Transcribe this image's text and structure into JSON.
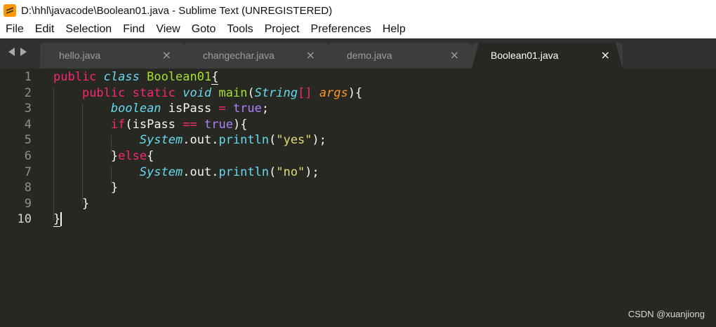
{
  "window": {
    "title": "D:\\hhl\\javacode\\Boolean01.java - Sublime Text (UNREGISTERED)",
    "icon": "sublime-text-icon"
  },
  "menu": [
    "File",
    "Edit",
    "Selection",
    "Find",
    "View",
    "Goto",
    "Tools",
    "Project",
    "Preferences",
    "Help"
  ],
  "tabs": [
    {
      "label": "hello.java",
      "close": "×",
      "active": false
    },
    {
      "label": "changechar.java",
      "close": "×",
      "active": false
    },
    {
      "label": "demo.java",
      "close": "×",
      "active": false
    },
    {
      "label": "Boolean01.java",
      "close": "×",
      "active": true
    }
  ],
  "editor": {
    "current_line": 10,
    "lines": [
      {
        "num": "1",
        "tokens": [
          {
            "t": "public",
            "c": "kw"
          },
          {
            "t": " ",
            "c": "plain"
          },
          {
            "t": "class",
            "c": "type"
          },
          {
            "t": " ",
            "c": "plain"
          },
          {
            "t": "Boolean01",
            "c": "cls"
          },
          {
            "t": "{",
            "c": "plain under"
          }
        ]
      },
      {
        "num": "2",
        "tokens": [
          {
            "t": "    ",
            "c": "plain"
          },
          {
            "t": "public",
            "c": "kw"
          },
          {
            "t": " ",
            "c": "plain"
          },
          {
            "t": "static",
            "c": "kw"
          },
          {
            "t": " ",
            "c": "plain"
          },
          {
            "t": "void",
            "c": "type"
          },
          {
            "t": " ",
            "c": "plain"
          },
          {
            "t": "main",
            "c": "cls"
          },
          {
            "t": "(",
            "c": "plain"
          },
          {
            "t": "String",
            "c": "type"
          },
          {
            "t": "[]",
            "c": "kw"
          },
          {
            "t": " ",
            "c": "plain"
          },
          {
            "t": "args",
            "c": "param"
          },
          {
            "t": "){",
            "c": "plain"
          }
        ]
      },
      {
        "num": "3",
        "tokens": [
          {
            "t": "        ",
            "c": "plain"
          },
          {
            "t": "boolean",
            "c": "type"
          },
          {
            "t": " isPass ",
            "c": "plain"
          },
          {
            "t": "=",
            "c": "kw"
          },
          {
            "t": " ",
            "c": "plain"
          },
          {
            "t": "true",
            "c": "const"
          },
          {
            "t": ";",
            "c": "plain"
          }
        ]
      },
      {
        "num": "4",
        "tokens": [
          {
            "t": "        ",
            "c": "plain"
          },
          {
            "t": "if",
            "c": "kw"
          },
          {
            "t": "(isPass ",
            "c": "plain"
          },
          {
            "t": "==",
            "c": "kw"
          },
          {
            "t": " ",
            "c": "plain"
          },
          {
            "t": "true",
            "c": "const"
          },
          {
            "t": "){",
            "c": "plain"
          }
        ]
      },
      {
        "num": "5",
        "tokens": [
          {
            "t": "            ",
            "c": "plain"
          },
          {
            "t": "System",
            "c": "type"
          },
          {
            "t": ".out.",
            "c": "plain"
          },
          {
            "t": "println",
            "c": "fn"
          },
          {
            "t": "(",
            "c": "plain"
          },
          {
            "t": "\"yes\"",
            "c": "str"
          },
          {
            "t": ");",
            "c": "plain"
          }
        ]
      },
      {
        "num": "6",
        "tokens": [
          {
            "t": "        }",
            "c": "plain"
          },
          {
            "t": "else",
            "c": "kw"
          },
          {
            "t": "{",
            "c": "plain"
          }
        ]
      },
      {
        "num": "7",
        "tokens": [
          {
            "t": "            ",
            "c": "plain"
          },
          {
            "t": "System",
            "c": "type"
          },
          {
            "t": ".out.",
            "c": "plain"
          },
          {
            "t": "println",
            "c": "fn"
          },
          {
            "t": "(",
            "c": "plain"
          },
          {
            "t": "\"no\"",
            "c": "str"
          },
          {
            "t": ");",
            "c": "plain"
          }
        ]
      },
      {
        "num": "8",
        "tokens": [
          {
            "t": "        }",
            "c": "plain"
          }
        ]
      },
      {
        "num": "9",
        "tokens": [
          {
            "t": "    }",
            "c": "plain"
          }
        ]
      },
      {
        "num": "10",
        "tokens": [
          {
            "t": "}",
            "c": "plain under"
          }
        ]
      }
    ]
  },
  "watermark": "CSDN @xuanjiong"
}
